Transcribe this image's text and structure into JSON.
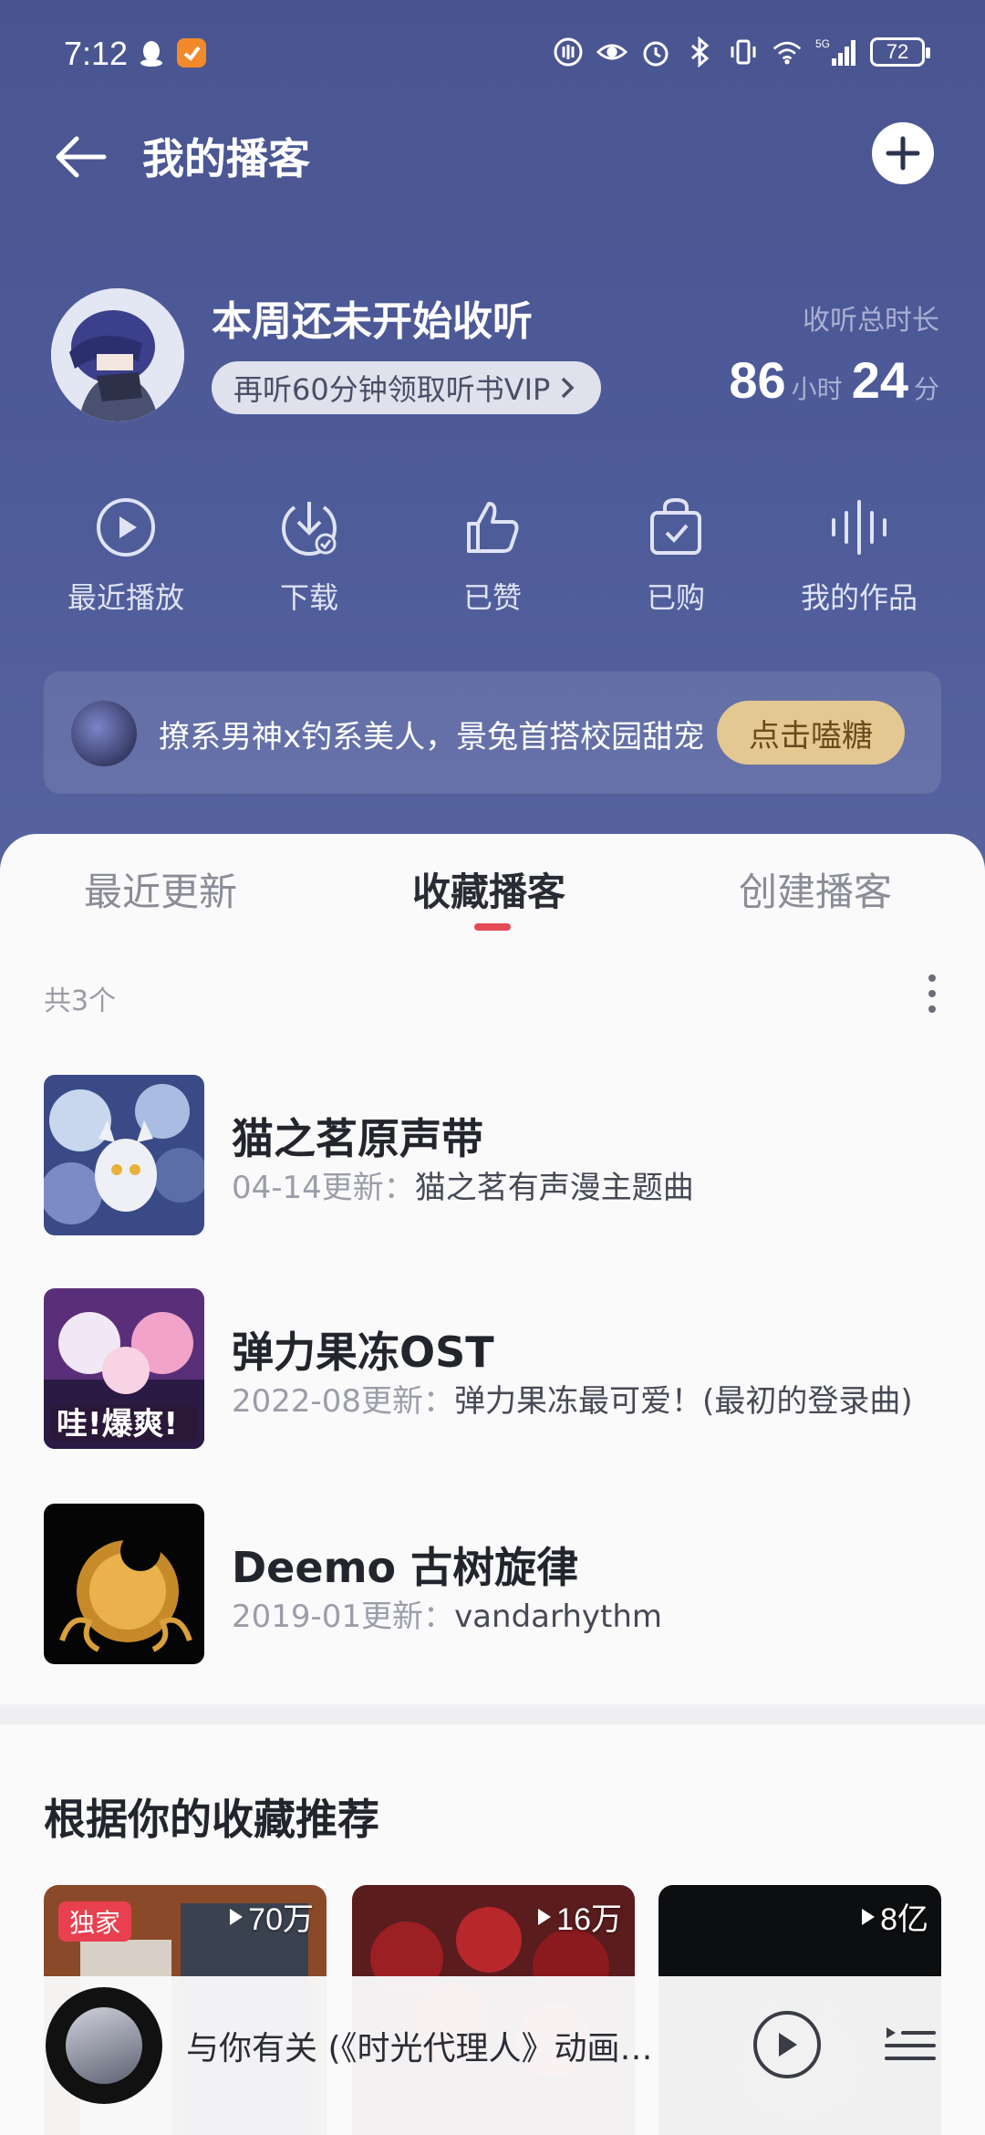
{
  "status_bar": {
    "time": "7:12",
    "battery": "72"
  },
  "header": {
    "title": "我的播客"
  },
  "profile": {
    "week_status": "本周还未开始收听",
    "vip_prompt": "再听60分钟领取听书VIP",
    "listen_label": "收听总时长",
    "hours": "86",
    "hours_unit": "小时",
    "minutes": "24",
    "minutes_unit": "分"
  },
  "quick_actions": [
    {
      "label": "最近播放",
      "icon": "play-circle-icon"
    },
    {
      "label": "下载",
      "icon": "download-icon"
    },
    {
      "label": "已赞",
      "icon": "thumbs-up-icon"
    },
    {
      "label": "已购",
      "icon": "purchased-bag-icon"
    },
    {
      "label": "我的作品",
      "icon": "sound-wave-icon"
    }
  ],
  "banner": {
    "text": "撩系男神x钓系美人，景兔首搭校园甜宠",
    "button": "点击嗑糖"
  },
  "tabs": [
    {
      "label": "最近更新"
    },
    {
      "label": "收藏播客"
    },
    {
      "label": "创建播客"
    }
  ],
  "collection": {
    "count_label": "共3个",
    "items": [
      {
        "title": "猫之茗原声带",
        "date": "04-14更新：",
        "desc": "猫之茗有声漫主题曲"
      },
      {
        "title": "弹力果冻OST",
        "date": "2022-08更新：",
        "desc": "弹力果冻最可爱！(最初的登录曲)"
      },
      {
        "title": "Deemo 古树旋律",
        "date": "2019-01更新：",
        "desc": "vandarhythm"
      }
    ]
  },
  "recommend": {
    "title": "根据你的收藏推荐",
    "cards": [
      {
        "badge": "独家",
        "plays": "70万"
      },
      {
        "badge": "",
        "plays": "16万"
      },
      {
        "badge": "",
        "plays": "8亿"
      }
    ]
  },
  "player": {
    "title": "与你有关 (《时光代理人》动画片尾曲)"
  },
  "colors": {
    "hero_bg": "#4e5b99",
    "accent": "#e44a56",
    "banner_button": "#e4c892"
  }
}
